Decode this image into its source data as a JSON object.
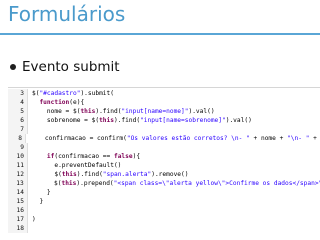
{
  "slide": {
    "title": "Formulários",
    "bullet": "Evento submit"
  },
  "code": {
    "lines": [
      {
        "num": "3",
        "text": "$(\"#cadastro\").submit("
      },
      {
        "num": "4",
        "text": "  function(e){"
      },
      {
        "num": "5",
        "text": "    nome = $(this).find(\"input[name=nome]\").val()"
      },
      {
        "num": "6",
        "text": "    sobrenome = $(this).find(\"input[name=sobrenome]\").val()"
      },
      {
        "num": "7",
        "text": ""
      },
      {
        "num": "8",
        "text": "    confirmacao = confirm(\"Os valores estão corretos? \\n- \" + nome + \"\\n- \" + sobrenome )"
      },
      {
        "num": "9",
        "text": ""
      },
      {
        "num": "10",
        "text": "    if(confirmacao == false){"
      },
      {
        "num": "11",
        "text": "      e.preventDefault()"
      },
      {
        "num": "12",
        "text": "      $(this).find(\"span.alerta\").remove()"
      },
      {
        "num": "13",
        "text": "      $(this).prepend(\"<span class=\\\"alerta yellow\\\">Confirme os dados</span>\")"
      },
      {
        "num": "14",
        "text": "    }"
      },
      {
        "num": "15",
        "text": "  }"
      },
      {
        "num": "16",
        "text": ""
      },
      {
        "num": "17",
        "text": ")"
      },
      {
        "num": "18",
        "text": ""
      }
    ]
  },
  "colors": {
    "title": "#4a9acb",
    "rule": "#5aa6d6",
    "keyword": "#7f0055",
    "string": "#2a00ff"
  }
}
